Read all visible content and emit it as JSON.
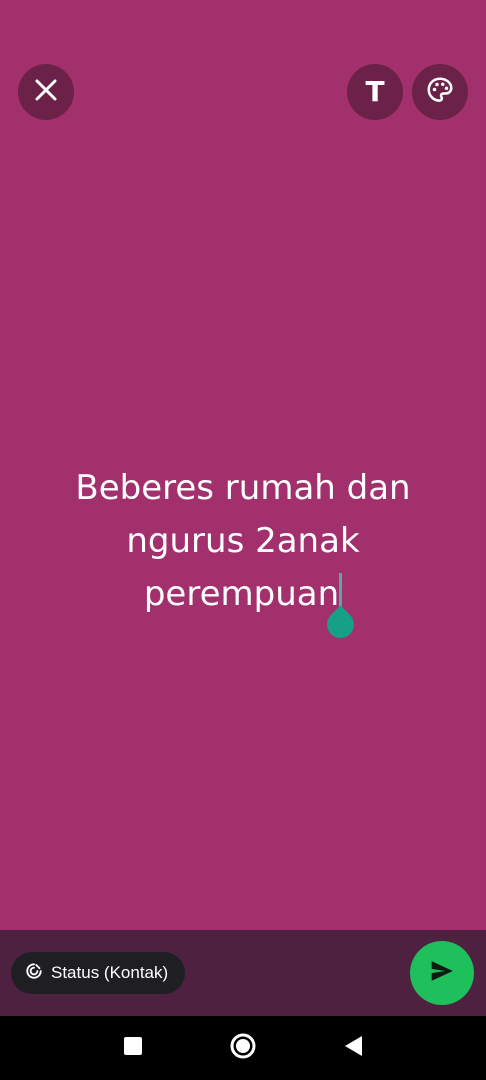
{
  "editor": {
    "background_color": "#a2306d",
    "text_color": "#ffffff",
    "status_text_lines": [
      "Beberes rumah dan",
      "ngurus 2anak",
      "perempuan"
    ]
  },
  "toolbar": {
    "close_icon": "close-icon",
    "text_style_label": "T",
    "palette_icon": "palette-icon"
  },
  "bottom": {
    "audience_label": "Status (Kontak)",
    "audience_icon": "status-ring-icon",
    "send_icon": "send-icon",
    "send_color": "#1fbf5b"
  },
  "navigation": {
    "recents_icon": "square-icon",
    "home_icon": "circle-icon",
    "back_icon": "triangle-back-icon"
  }
}
